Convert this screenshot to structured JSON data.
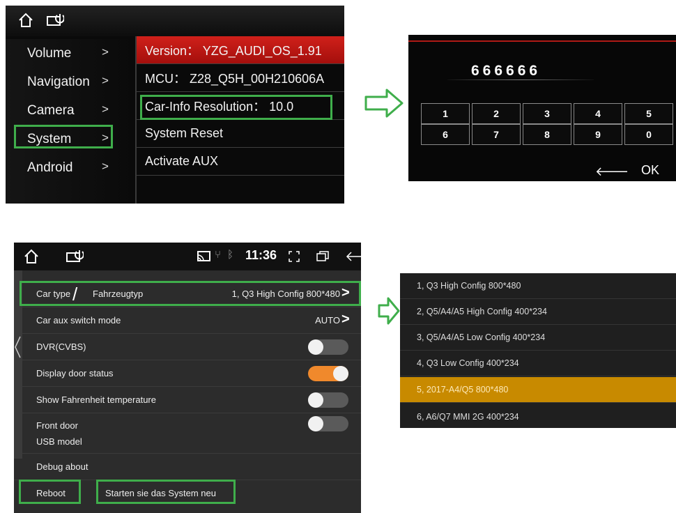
{
  "system_menu": {
    "items": [
      {
        "label": "Volume",
        "chevron": ">"
      },
      {
        "label": "Navigation",
        "chevron": ">"
      },
      {
        "label": "Camera",
        "chevron": ">"
      },
      {
        "label": "System",
        "chevron": ">"
      },
      {
        "label": "Android",
        "chevron": ">"
      }
    ],
    "info": [
      {
        "text": "Version： YZG_AUDI_OS_1.91"
      },
      {
        "text": "MCU： Z28_Q5H_00H210606A"
      },
      {
        "text": "Car-Info Resolution： 10.0"
      },
      {
        "text": "System Reset"
      },
      {
        "text": "Activate AUX"
      }
    ]
  },
  "keypad": {
    "pin": "666666",
    "keys": [
      "1",
      "2",
      "3",
      "4",
      "5",
      "6",
      "7",
      "8",
      "9",
      "0"
    ],
    "back": "🡐",
    "ok": "OK"
  },
  "settings": {
    "status_time": "11:36",
    "rows": [
      {
        "label": "Car type",
        "slash": "/",
        "label2": "Fahrzeugtyp",
        "value": "1, Q3 High Config 800*480",
        "chevron": ">"
      },
      {
        "label": "Car aux switch mode",
        "value": "AUTO",
        "chevron": ">"
      },
      {
        "label": "DVR(CVBS)",
        "toggle": "off"
      },
      {
        "label": "Display door status",
        "toggle": "on"
      },
      {
        "label": "Show Fahrenheit temperature",
        "toggle": "off"
      },
      {
        "label": "Front door",
        "label2": "USB model",
        "toggle": "off"
      },
      {
        "label": "Debug about"
      },
      {
        "label": "Reboot",
        "note": "Starten sie das System neu"
      }
    ]
  },
  "car_types": {
    "items": [
      "1, Q3 High Config 800*480",
      "2, Q5/A4/A5 High Config 400*234",
      "3, Q5/A4/A5 Low Config 400*234",
      "4, Q3 Low Config 400*234",
      "5, 2017-A4/Q5 800*480",
      "6, A6/Q7 MMI 2G 400*234"
    ],
    "selected_index": 4
  },
  "colors": {
    "highlight_green": "#3fae4b",
    "version_red": "#c41a15",
    "toggle_on": "#f0892c",
    "selected_gold": "#c88a00"
  }
}
